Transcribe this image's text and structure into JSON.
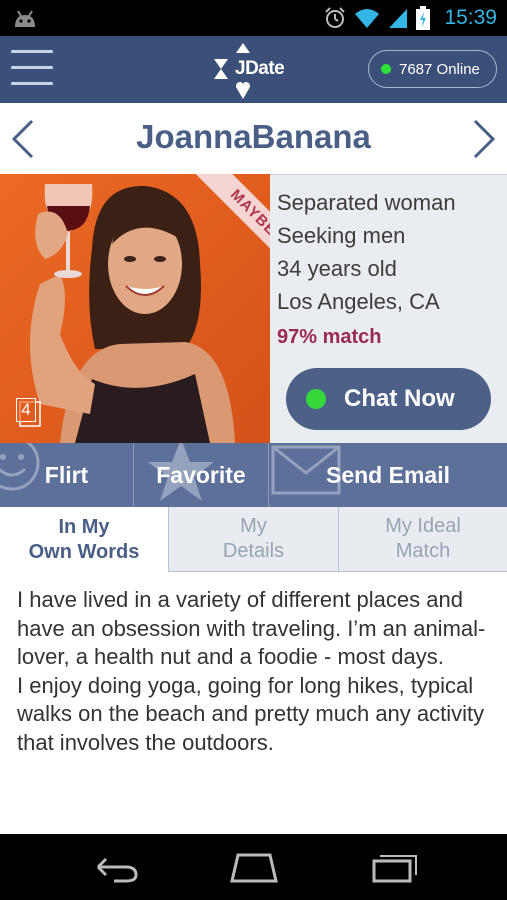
{
  "status_bar": {
    "time": "15:39"
  },
  "header": {
    "logo_text": "JDate",
    "online_label": "7687 Online"
  },
  "profile": {
    "name": "JoannaBanana",
    "photo_badge": "MAYBE",
    "photo_count": "4",
    "info": {
      "status": "Separated woman",
      "seeking": "Seeking men",
      "age": "34 years old",
      "location": "Los Angeles, CA",
      "match": "97% match"
    },
    "chat_label": "Chat Now"
  },
  "actions": [
    {
      "label": "Flirt",
      "icon": "smiley-icon"
    },
    {
      "label": "Favorite",
      "icon": "star-icon"
    },
    {
      "label": "Send Email",
      "icon": "envelope-icon"
    }
  ],
  "tabs": [
    {
      "line1": "In My",
      "line2": "Own Words",
      "active": true
    },
    {
      "line1": "My",
      "line2": "Details",
      "active": false
    },
    {
      "line1": "My Ideal",
      "line2": "Match",
      "active": false
    }
  ],
  "about": {
    "para1": "I have lived in a variety of different places and have an obsession with traveling. I’m an animal-lover, a health nut and a foodie - most days.",
    "para2": "I enjoy doing yoga, going for long hikes, typical walks on the beach and pretty much any activity that involves the outdoors."
  },
  "colors": {
    "header": "#3b5078",
    "accent_blue": "#4a5f86",
    "match": "#9c2857",
    "online": "#2fe03a",
    "photo_bg": "#e35a1c"
  }
}
